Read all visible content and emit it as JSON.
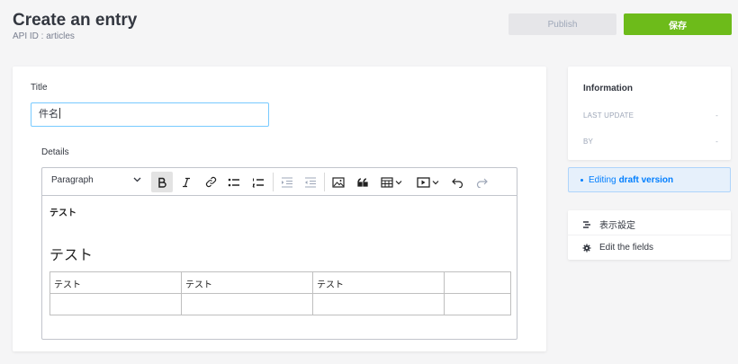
{
  "header": {
    "title": "Create an entry",
    "api_id": "API ID : articles",
    "publish_label": "Publish",
    "save_label": "保存"
  },
  "form": {
    "title_label": "Title",
    "title_value": "件名",
    "details_label": "Details"
  },
  "editor": {
    "block_format": "Paragraph",
    "toolbar_icons": [
      "bold-icon",
      "italic-icon",
      "link-icon",
      "bullet-list-icon",
      "numbered-list-icon",
      "outdent-icon",
      "indent-icon",
      "image-icon",
      "quote-icon",
      "table-icon",
      "media-icon",
      "undo-icon",
      "redo-icon"
    ],
    "content_bold": "テスト",
    "content_heading": "テスト",
    "table": [
      [
        "テスト",
        "テスト",
        "テスト",
        ""
      ],
      [
        "",
        "",
        "",
        ""
      ]
    ]
  },
  "sidebar": {
    "info_title": "Information",
    "last_update_label": "LAST UPDATE",
    "last_update_value": "-",
    "by_label": "BY",
    "by_value": "-",
    "draft_prefix": "Editing",
    "draft_bold": "draft version",
    "display_settings": "表示設定",
    "edit_fields": "Edit the fields"
  },
  "colors": {
    "save": "#6dbb1a",
    "publish_disabled": "#e6e6e9",
    "draft_accent": "#007eff",
    "input_focus": "#78caff"
  }
}
